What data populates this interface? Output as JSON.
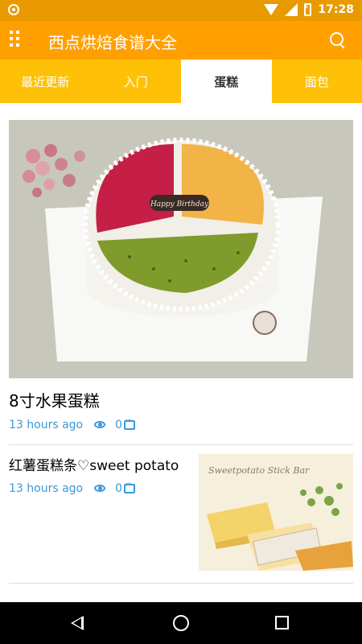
{
  "status_bar": {
    "time": "17:28"
  },
  "app_bar": {
    "title": "西点烘焙食谱大全"
  },
  "tabs": [
    {
      "label": "最近更新",
      "active": false
    },
    {
      "label": "入门",
      "active": false
    },
    {
      "label": "蛋糕",
      "active": true
    },
    {
      "label": "面包",
      "active": false
    }
  ],
  "items": [
    {
      "title": "8寸水果蛋糕",
      "time": "13 hours ago",
      "comments": "0",
      "image_text": "Happy Birthday"
    },
    {
      "title": "红薯蛋糕条♡sweet potato",
      "time": "13 hours ago",
      "comments": "0",
      "image_text": "Sweetpotato Stick Bar"
    }
  ],
  "colors": {
    "status_bar": "#e89a00",
    "app_bar": "#ffa000",
    "tabs": "#ffc107",
    "meta": "#3a9ad9"
  }
}
